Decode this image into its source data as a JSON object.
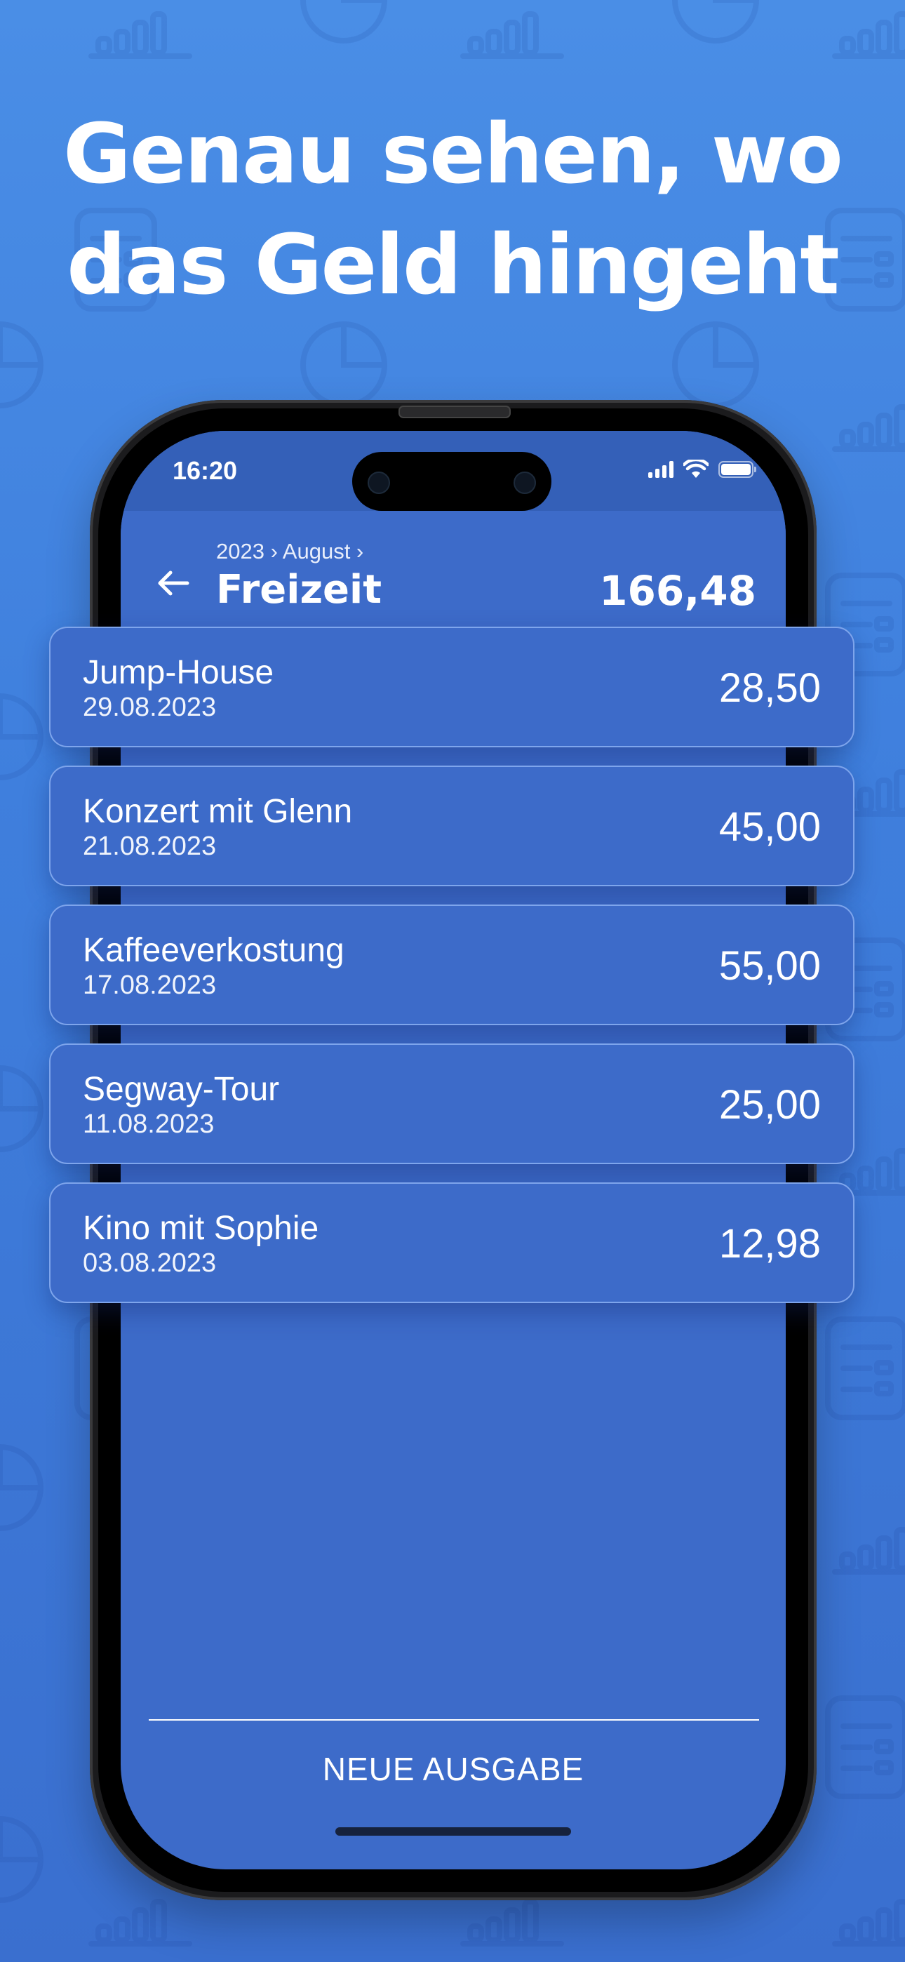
{
  "headline": {
    "line1": "Genau sehen, wo",
    "line2": "das Geld hingeht"
  },
  "status_bar": {
    "time": "16:20",
    "icons": [
      "signal-icon",
      "wifi-icon",
      "battery-icon"
    ]
  },
  "header": {
    "breadcrumb": "2023 › August ›",
    "title": "Freizeit",
    "total": "166,48",
    "back_icon": "arrow-left-icon"
  },
  "expenses": [
    {
      "title": "Jump-House",
      "date": "29.08.2023",
      "amount": "28,50"
    },
    {
      "title": "Konzert mit Glenn",
      "date": "21.08.2023",
      "amount": "45,00"
    },
    {
      "title": "Kaffeeverkostung",
      "date": "17.08.2023",
      "amount": "55,00"
    },
    {
      "title": "Segway-Tour",
      "date": "11.08.2023",
      "amount": "25,00"
    },
    {
      "title": "Kino mit Sophie",
      "date": "03.08.2023",
      "amount": "12,98"
    }
  ],
  "footer": {
    "new_expense_label": "NEUE AUSGABE"
  },
  "colors": {
    "background_top": "#4a8ee6",
    "background_bottom": "#3a6fcf",
    "screen": "#3d6bc9",
    "card_border": "#7ea5ec",
    "text": "#ffffff"
  }
}
